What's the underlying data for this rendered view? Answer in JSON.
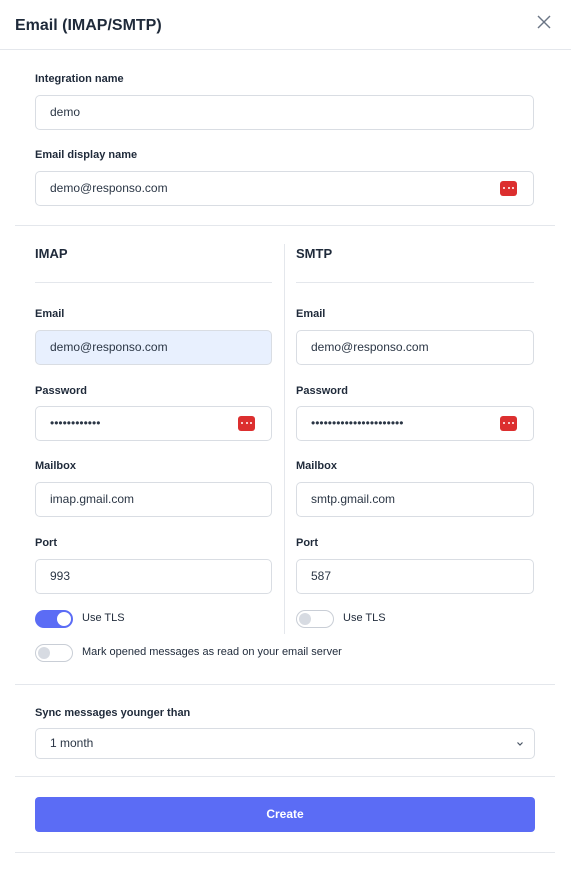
{
  "dialog": {
    "title": "Email (IMAP/SMTP)"
  },
  "general": {
    "integration_name_label": "Integration name",
    "integration_name_value": "demo",
    "display_name_label": "Email display name",
    "display_name_value": "demo@responso.com"
  },
  "imap": {
    "title": "IMAP",
    "email_label": "Email",
    "email_value": "demo@responso.com",
    "password_label": "Password",
    "password_value": "••••••••••••",
    "mailbox_label": "Mailbox",
    "mailbox_value": "imap.gmail.com",
    "port_label": "Port",
    "port_value": "993",
    "tls_label": "Use TLS",
    "tls_enabled": true
  },
  "smtp": {
    "title": "SMTP",
    "email_label": "Email",
    "email_value": "demo@responso.com",
    "password_label": "Password",
    "password_value": "••••••••••••••••••••••",
    "mailbox_label": "Mailbox",
    "mailbox_value": "smtp.gmail.com",
    "port_label": "Port",
    "port_value": "587",
    "tls_label": "Use TLS",
    "tls_enabled": false
  },
  "mark_read": {
    "label": "Mark opened messages as read on your email server",
    "enabled": false
  },
  "sync": {
    "label": "Sync messages younger than",
    "selected": "1 month"
  },
  "actions": {
    "create_label": "Create"
  },
  "colors": {
    "accent": "#5b6cf5",
    "password_manager_icon": "#dc2f2f",
    "autofill_bg": "#e8f0fe"
  }
}
